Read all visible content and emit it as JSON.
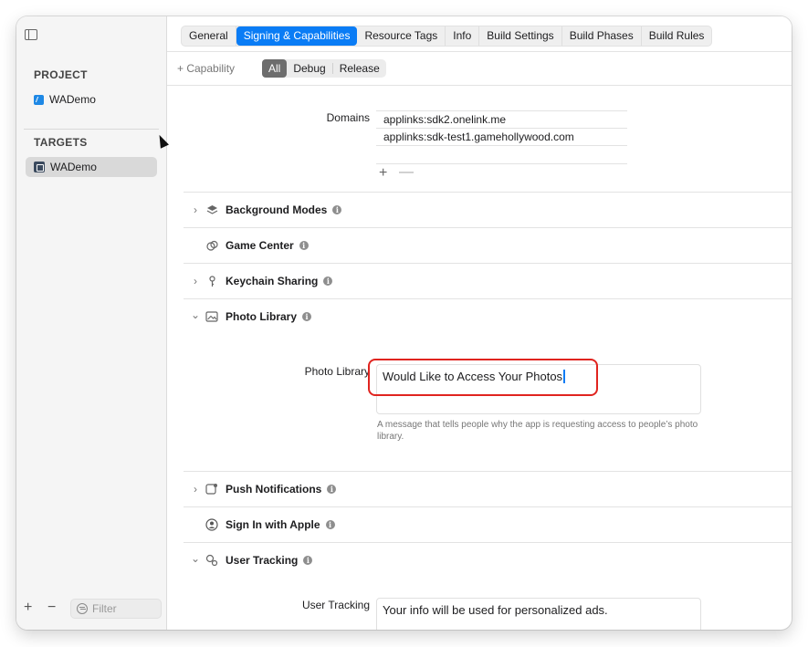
{
  "sidebar": {
    "project_heading": "PROJECT",
    "project_name": "WADemo",
    "targets_heading": "TARGETS",
    "target_name": "WADemo",
    "filter_placeholder": "Filter",
    "add_label": "+",
    "remove_label": "−"
  },
  "tabs": [
    "General",
    "Signing & Capabilities",
    "Resource Tags",
    "Info",
    "Build Settings",
    "Build Phases",
    "Build Rules"
  ],
  "active_tab": "Signing & Capabilities",
  "filterbar": {
    "add_capability_label": "+ Capability",
    "segments": [
      "All",
      "Debug",
      "Release"
    ],
    "active_segment": "All"
  },
  "associated_domains": {
    "label": "Domains",
    "domains": [
      "applinks:sdk2.onelink.me",
      "applinks:sdk-test1.gamehollywood.com"
    ],
    "add_label": "+",
    "remove_label": "—"
  },
  "capabilities": {
    "background_modes": "Background Modes",
    "game_center": "Game Center",
    "keychain_sharing": "Keychain Sharing",
    "photo_library": "Photo Library",
    "push_notifications": "Push Notifications",
    "sign_in_with_apple": "Sign In with Apple",
    "user_tracking": "User Tracking"
  },
  "photo_library_field": {
    "label": "Photo Library",
    "value": "Would Like to Access Your Photos",
    "help": "A message that tells people why the app is requesting access to people’s photo library."
  },
  "user_tracking_field": {
    "label": "User Tracking",
    "value": "Your info will be used for personalized ads."
  },
  "info_glyph": "i",
  "chevron_right": "›",
  "chevron_down": "⌄",
  "colors": {
    "accent": "#0a7cf5",
    "highlight": "#e0241f"
  }
}
